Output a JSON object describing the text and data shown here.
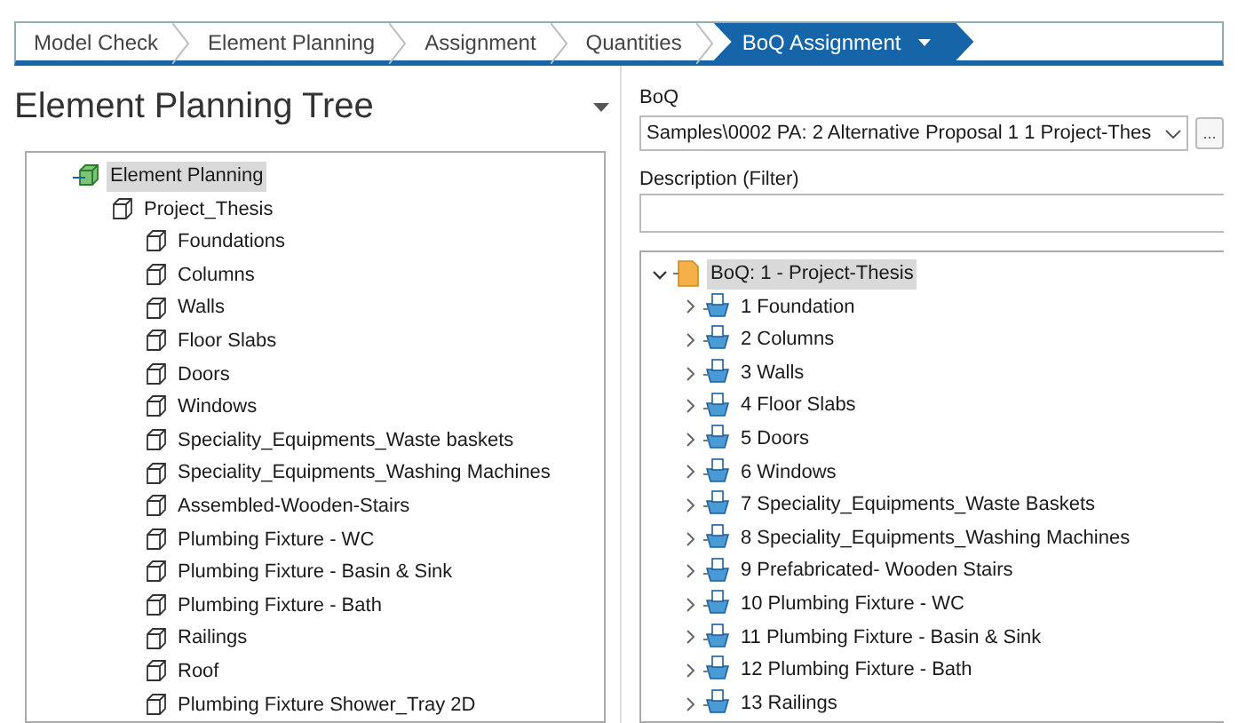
{
  "breadcrumb": [
    {
      "label": "Model Check",
      "selected": false
    },
    {
      "label": "Element Planning",
      "selected": false
    },
    {
      "label": "Assignment",
      "selected": false
    },
    {
      "label": "Quantities",
      "selected": false
    },
    {
      "label": "BoQ Assignment",
      "selected": true
    }
  ],
  "left_panel": {
    "title": "Element Planning Tree",
    "tree": [
      {
        "label": "Element Planning",
        "selected": true,
        "children": [
          {
            "label": "Project_Thesis",
            "selected": false,
            "children": [
              {
                "label": "Foundations",
                "selected": false
              },
              {
                "label": "Columns",
                "selected": false
              },
              {
                "label": "Walls",
                "selected": false
              },
              {
                "label": "Floor Slabs",
                "selected": false
              },
              {
                "label": "Doors",
                "selected": false
              },
              {
                "label": "Windows",
                "selected": false
              },
              {
                "label": "Speciality_Equipments_Waste baskets",
                "selected": false
              },
              {
                "label": "Speciality_Equipments_Washing Machines",
                "selected": false
              },
              {
                "label": "Assembled-Wooden-Stairs",
                "selected": false
              },
              {
                "label": "Plumbing Fixture - WC",
                "selected": false
              },
              {
                "label": "Plumbing Fixture - Basin & Sink",
                "selected": false
              },
              {
                "label": "Plumbing Fixture - Bath",
                "selected": false
              },
              {
                "label": "Railings",
                "selected": false
              },
              {
                "label": "Roof",
                "selected": false
              },
              {
                "label": "Plumbing Fixture Shower_Tray 2D",
                "selected": false
              }
            ]
          }
        ]
      }
    ]
  },
  "right_panel": {
    "boq_label": "BoQ",
    "boq_value": "Samples\\0002 PA: 2 Alternative Proposal 1 1 Project-Thes",
    "browse_button": "...",
    "filter_label": "Description (Filter)",
    "tree": [
      {
        "label": "BoQ: 1 - Project-Thesis",
        "selected": true,
        "expanded": true,
        "children": [
          {
            "label": "1 Foundation",
            "selected": false,
            "expanded": false
          },
          {
            "label": "2 Columns",
            "selected": false,
            "expanded": false
          },
          {
            "label": "3 Walls",
            "selected": false,
            "expanded": false
          },
          {
            "label": "4 Floor Slabs",
            "selected": false,
            "expanded": false
          },
          {
            "label": "5 Doors",
            "selected": false,
            "expanded": false
          },
          {
            "label": "6 Windows",
            "selected": false,
            "expanded": false
          },
          {
            "label": "7 Speciality_Equipments_Waste Baskets",
            "selected": false,
            "expanded": false
          },
          {
            "label": "8 Speciality_Equipments_Washing Machines",
            "selected": false,
            "expanded": false
          },
          {
            "label": "9 Prefabricated- Wooden Stairs",
            "selected": false,
            "expanded": false
          },
          {
            "label": "10 Plumbing Fixture - WC",
            "selected": false,
            "expanded": false
          },
          {
            "label": "11 Plumbing Fixture - Basin & Sink",
            "selected": false,
            "expanded": false
          },
          {
            "label": "12 Plumbing Fixture - Bath",
            "selected": false,
            "expanded": false
          },
          {
            "label": "13 Railings",
            "selected": false,
            "expanded": false
          }
        ]
      }
    ]
  }
}
